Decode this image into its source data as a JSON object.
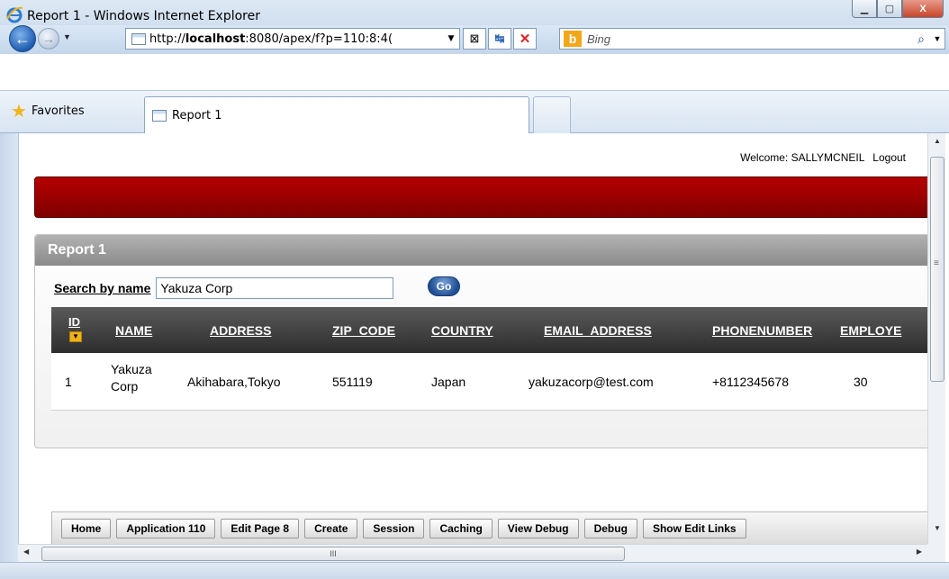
{
  "window": {
    "title": "Report 1 - Windows Internet Explorer",
    "min_icon": "minimize-icon",
    "max_icon": "maximize-icon",
    "close_icon": "close-icon",
    "min_glyph": "▁",
    "max_glyph": "▢",
    "close_glyph": "X"
  },
  "nav": {
    "back_glyph": "←",
    "forward_glyph": "→",
    "history_glyph": "▼",
    "url_prefix": "http://",
    "url_host": "localhost",
    "url_rest": ":8080/apex/f?p=110:8:4(",
    "url_dropdown": "▼",
    "compat_glyph": "⊠",
    "refresh_glyph": "↹",
    "stop_glyph": "✕",
    "search_placeholder": "Bing",
    "bing_glyph": "b",
    "search_glyph": "⌕",
    "search_dropdown": "▼"
  },
  "favorites": {
    "label": "Favorites",
    "star_glyph": "★"
  },
  "tab": {
    "label": "Report 1"
  },
  "page": {
    "welcome_label": "Welcome: SALLYMCNEIL",
    "logout_label": "Logout",
    "region_title": "Report 1",
    "search_label": "Search by name",
    "search_value": "Yakuza Corp",
    "go_label": "Go"
  },
  "table": {
    "columns": [
      "ID",
      "NAME",
      "ADDRESS",
      "ZIP_CODE",
      "COUNTRY",
      "EMAIL_ADDRESS",
      "PHONENUMBER",
      "EMPLOYE"
    ],
    "sort_glyph": "▼",
    "rows": [
      {
        "id": "1",
        "name_line1": "Yakuza",
        "name_line2": "Corp",
        "address": "Akihabara,Tokyo",
        "zip_code": "551119",
        "country": "Japan",
        "email": "yakuzacorp@test.com",
        "phone": "+8112345678",
        "employees": "30"
      }
    ]
  },
  "dev_toolbar": [
    "Home",
    "Application 110",
    "Edit Page 8",
    "Create",
    "Session",
    "Caching",
    "View Debug",
    "Debug",
    "Show Edit Links"
  ],
  "scrollbars": {
    "up_glyph": "▲",
    "down_glyph": "▼",
    "left_glyph": "◀",
    "right_glyph": "▶",
    "grip_glyph": "III",
    "vgrip_glyph": "≡"
  },
  "colors": {
    "banner": "#b50000",
    "header": "#2d2d2d",
    "sort_icon": "#f0b31b",
    "go_button": "#1f4f94"
  }
}
